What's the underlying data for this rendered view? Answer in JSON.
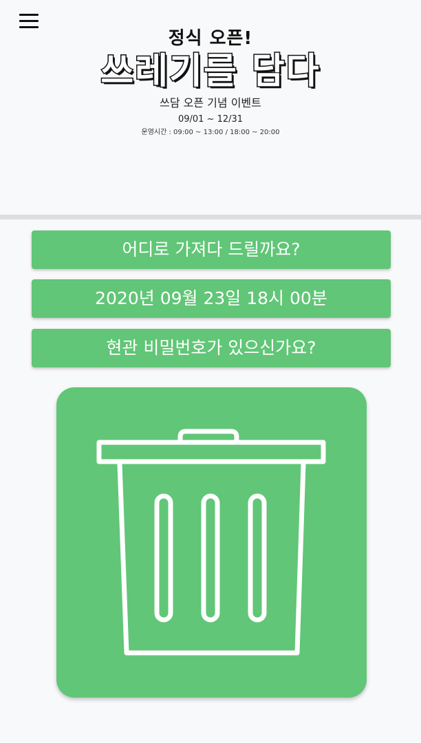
{
  "menu": {
    "icon": "hamburger-menu-icon"
  },
  "banner": {
    "kicker": "정식 오픈!",
    "title": "쓰레기를 담다",
    "subtitle": "쓰담 오픈 기념 이벤트",
    "dates": "09/01 ~ 12/31",
    "hours": "운영시간 : 09:00 ~ 13:00 / 18:00 ~ 20:00"
  },
  "actions": {
    "destination_label": "어디로 가져다 드릴까요?",
    "datetime_label": "2020년 09월 23일 18시 00분",
    "password_label": "현관 비밀번호가 있으신가요?"
  },
  "trash": {
    "icon": "trash-can-icon"
  },
  "colors": {
    "accent": "#61c677",
    "divider": "#dcdee2",
    "background": "#f8f9fb"
  }
}
